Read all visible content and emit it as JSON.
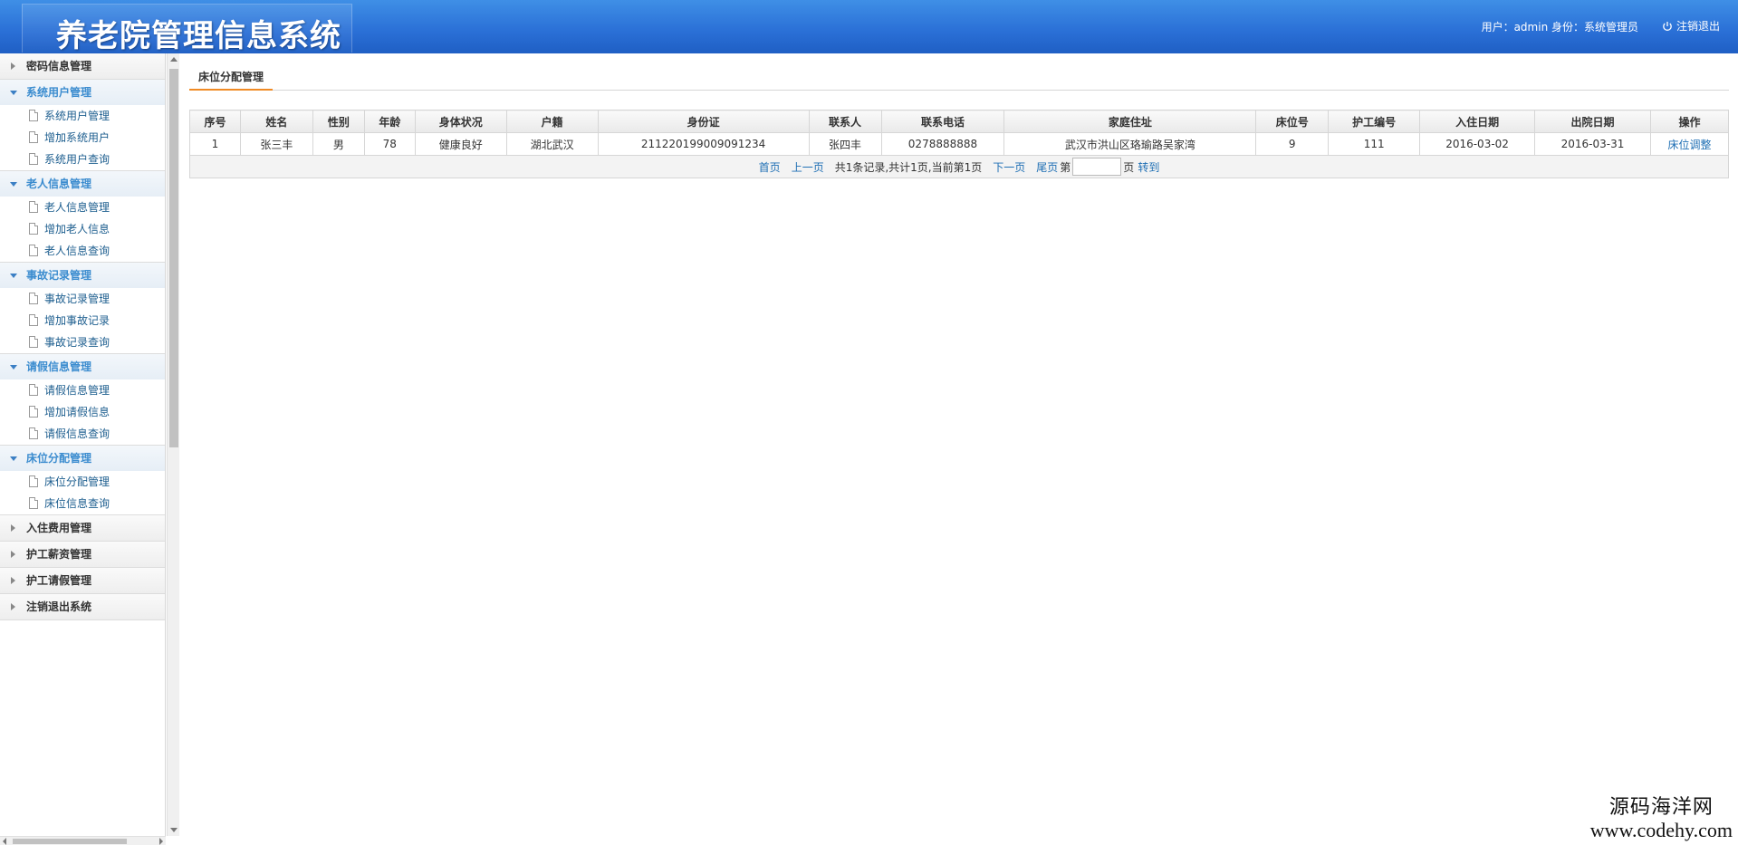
{
  "header": {
    "title": "养老院管理信息系统",
    "user_info": "用户：admin 身份：系统管理员",
    "logout_label": "注销退出"
  },
  "sidebar": {
    "groups": [
      {
        "label": "密码信息管理",
        "state": "collapsed",
        "items": []
      },
      {
        "label": "系统用户管理",
        "state": "open",
        "items": [
          "系统用户管理",
          "增加系统用户",
          "系统用户查询"
        ]
      },
      {
        "label": "老人信息管理",
        "state": "open",
        "items": [
          "老人信息管理",
          "增加老人信息",
          "老人信息查询"
        ]
      },
      {
        "label": "事故记录管理",
        "state": "open",
        "items": [
          "事故记录管理",
          "增加事故记录",
          "事故记录查询"
        ]
      },
      {
        "label": "请假信息管理",
        "state": "open",
        "items": [
          "请假信息管理",
          "增加请假信息",
          "请假信息查询"
        ]
      },
      {
        "label": "床位分配管理",
        "state": "open",
        "items": [
          "床位分配管理",
          "床位信息查询"
        ]
      },
      {
        "label": "入住费用管理",
        "state": "collapsed",
        "items": []
      },
      {
        "label": "护工薪资管理",
        "state": "collapsed",
        "items": []
      },
      {
        "label": "护工请假管理",
        "state": "collapsed",
        "items": []
      },
      {
        "label": "注销退出系统",
        "state": "collapsed",
        "items": []
      }
    ]
  },
  "main": {
    "tab_label": "床位分配管理",
    "table": {
      "columns": [
        "序号",
        "姓名",
        "性别",
        "年龄",
        "身体状况",
        "户籍",
        "身份证",
        "联系人",
        "联系电话",
        "家庭住址",
        "床位号",
        "护工编号",
        "入住日期",
        "出院日期",
        "操作"
      ],
      "rows": [
        [
          "1",
          "张三丰",
          "男",
          "78",
          "健康良好",
          "湖北武汉",
          "211220199009091234",
          "张四丰",
          "0278888888",
          "武汉市洪山区珞瑜路吴家湾",
          "9",
          "111",
          "2016-03-02",
          "2016-03-31",
          "床位调整"
        ]
      ]
    },
    "pager": {
      "first": "首页",
      "prev": "上一页",
      "info": "共1条记录,共计1页,当前第1页",
      "next": "下一页",
      "last": "尾页",
      "page_prefix": "第",
      "page_suffix": "页",
      "goto": "转到",
      "page_input_value": ""
    }
  },
  "watermark": {
    "line1": "源码海洋网",
    "line2": "www.codehy.com"
  },
  "colors": {
    "header_blue": "#2a6fd6",
    "link_blue": "#1f6fb4",
    "tab_accent": "#f08a24",
    "open_group_text": "#3b8ccf"
  }
}
